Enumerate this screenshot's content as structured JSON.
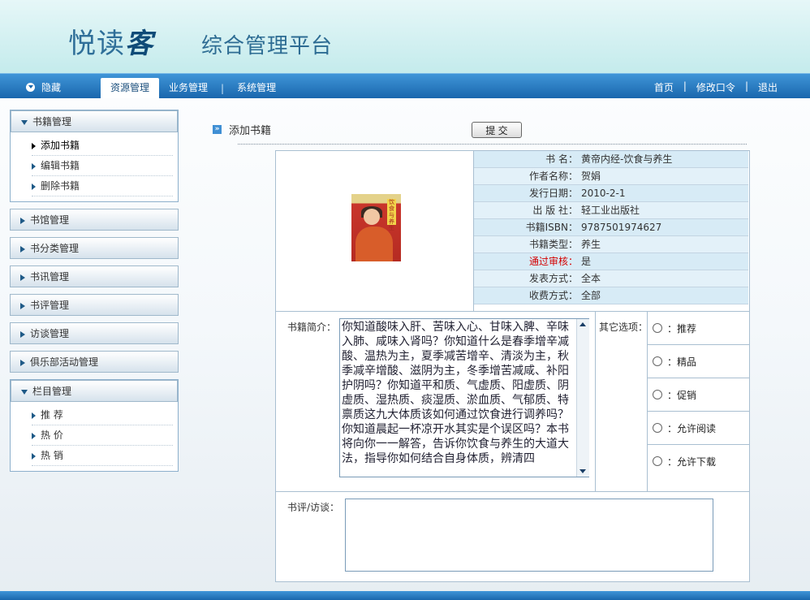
{
  "header": {
    "logo_a": "悦读",
    "logo_b": "客",
    "platform_title": "综合管理平台"
  },
  "nav": {
    "hide_label": "隐藏",
    "tabs": [
      {
        "label": "资源管理",
        "active": true
      },
      {
        "label": "业务管理",
        "active": false
      },
      {
        "label": "系统管理",
        "active": false
      }
    ],
    "right": {
      "home": "首页",
      "change_password": "修改口令",
      "logout": "退出"
    }
  },
  "sidebar": {
    "book_mgmt": {
      "title": "书籍管理",
      "items": [
        "添加书籍",
        "编辑书籍",
        "删除书籍"
      ]
    },
    "sections": [
      "书馆管理",
      "书分类管理",
      "书讯管理",
      "书评管理",
      "访谈管理",
      "俱乐部活动管理"
    ],
    "column_mgmt": {
      "title": "栏目管理",
      "items": [
        "推 荐",
        "热 价",
        "热 销"
      ]
    }
  },
  "main": {
    "title": "添加书籍",
    "submit_label": "提 交"
  },
  "book": {
    "fields": [
      {
        "label": "书    名：",
        "value": "黄帝内经-饮食与养生"
      },
      {
        "label": "作者名称：",
        "value": "贺娟"
      },
      {
        "label": "发行日期：",
        "value": "2010-2-1"
      },
      {
        "label": "出 版 社：",
        "value": "轻工业出版社"
      },
      {
        "label": "书籍ISBN：",
        "value": "9787501974627"
      },
      {
        "label": "书籍类型：",
        "value": "养生"
      },
      {
        "label": "通过审核：",
        "value": "是"
      },
      {
        "label": "发表方式：",
        "value": "全本"
      },
      {
        "label": "收费方式：",
        "value": "全部"
      }
    ],
    "cover_text": "饮食与养生",
    "intro_label": "书籍简介：",
    "intro_text": "你知道酸味入肝、苦味入心、甘味入脾、辛味入肺、咸味入肾吗？你知道什么是春季增辛减酸、温热为主，夏季减苦增辛、清淡为主，秋季减辛增酸、滋阴为主，冬季增苦减咸、补阳护阴吗？你知道平和质、气虚质、阳虚质、阴虚质、湿热质、痰湿质、淤血质、气郁质、特禀质这九大体质该如何通过饮食进行调养吗？你知道晨起一杯凉开水其实是个误区吗？本书将向你一一解答，告诉你饮食与养生的大道大法，指导你如何结合自身体质，辨清四",
    "other_label": "其它选项：",
    "options": [
      "：推荐",
      "：精品",
      "：促销",
      "：允许阅读",
      "：允许下载"
    ],
    "review_label": "书评/访谈："
  },
  "colors": {
    "nav_blue": "#1a67ad",
    "header_teal": "#c4ebec",
    "audit_red": "#d40000"
  }
}
